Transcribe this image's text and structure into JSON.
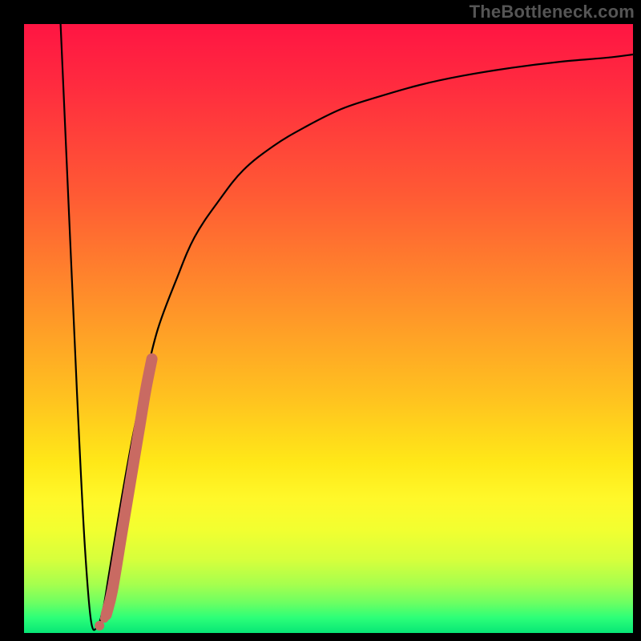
{
  "watermark": "TheBottleneck.com",
  "chart_data": {
    "type": "line",
    "title": "",
    "xlabel": "",
    "ylabel": "",
    "xlim": [
      0,
      100
    ],
    "ylim": [
      0,
      100
    ],
    "series": [
      {
        "name": "bottleneck-curve",
        "color": "#000000",
        "x": [
          6,
          8,
          9,
          10,
          11,
          12,
          13,
          14,
          16,
          18,
          20,
          22,
          25,
          28,
          32,
          36,
          41,
          46,
          52,
          58,
          65,
          72,
          80,
          88,
          96,
          100
        ],
        "y": [
          100,
          55,
          33,
          14,
          2,
          1,
          4,
          10,
          22,
          33,
          42,
          50,
          58,
          65,
          71,
          76,
          80,
          83,
          86,
          88,
          90,
          91.5,
          92.8,
          93.8,
          94.5,
          95
        ]
      },
      {
        "name": "highlight-segment",
        "color": "#c96a62",
        "x": [
          13.5,
          14.5,
          16.0,
          17.0,
          18.0,
          19.0,
          20.0,
          21.0
        ],
        "y": [
          3,
          7,
          16,
          22,
          28,
          34,
          40,
          45
        ]
      },
      {
        "name": "highlight-dots",
        "color": "#c96a62",
        "x": [
          12.4,
          13.2,
          14.0
        ],
        "y": [
          1.2,
          2.4,
          5.0
        ]
      }
    ],
    "gradient_stops": [
      {
        "pos": 0,
        "color": "#ff1543"
      },
      {
        "pos": 0.45,
        "color": "#ff8e2a"
      },
      {
        "pos": 0.72,
        "color": "#ffe818"
      },
      {
        "pos": 0.88,
        "color": "#d6ff3c"
      },
      {
        "pos": 1.0,
        "color": "#07e676"
      }
    ]
  }
}
